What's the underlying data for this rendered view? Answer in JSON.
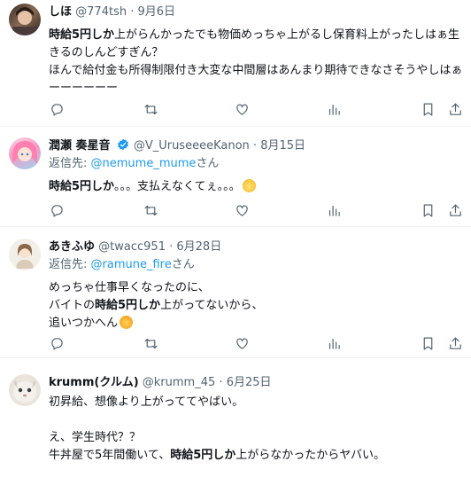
{
  "posts": [
    {
      "name": "しほ",
      "handle": "@774tsh",
      "dot": "·",
      "date": "9月6日",
      "lines": [
        {
          "b": "時給5円しか",
          "t": "上がらんかったでも物価めっちゃ上がるし保育料上がったしはぁ生きるのしんどすぎん？"
        },
        {
          "b": "",
          "t": "ほんで給付金も所得制限付き大変な中間層はあんまり期待できなさそうやしはぁーーーーーー"
        }
      ]
    },
    {
      "name": "潤瀬 奏星音",
      "handle": "@V_UruseeeeKanon",
      "dot": "·",
      "date": "8月15日",
      "reply_prefix": "返信先: ",
      "reply_to": "@nemume_mume",
      "reply_suffix": "さん",
      "line1_b": "時給5円しか",
      "line1_t": "。。。支払えなくてぇ。。。"
    },
    {
      "name": "あきふゆ",
      "handle": "@twacc951",
      "dot": "·",
      "date": "6月28日",
      "reply_prefix": "返信先: ",
      "reply_to": "@ramune_fire",
      "reply_suffix": "さん",
      "line1": "めっちゃ仕事早くなったのに、",
      "line2_pre": "バイトの",
      "line2_b": "時給5円しか",
      "line2_post": "上がってないから、",
      "line3": "追いつかへん"
    },
    {
      "name": "krumm(クルム)",
      "handle": "@krumm_45",
      "dot": "·",
      "date": "6月25日",
      "line1": "初昇給、想像より上がっててやばい。",
      "line2": "え、学生時代？？",
      "line3_pre": "牛丼屋で5年間働いて、",
      "line3_b": "時給5円しか",
      "line3_post": "上がらなかったからヤバい。"
    }
  ],
  "icons": [
    "reply-icon",
    "retweet-icon",
    "like-icon",
    "views-icon",
    "bookmark-icon",
    "share-icon"
  ],
  "colors": {
    "link": "#1d9bf0",
    "muted": "#536471",
    "text": "#0f1419",
    "divider": "#eff3f4"
  }
}
